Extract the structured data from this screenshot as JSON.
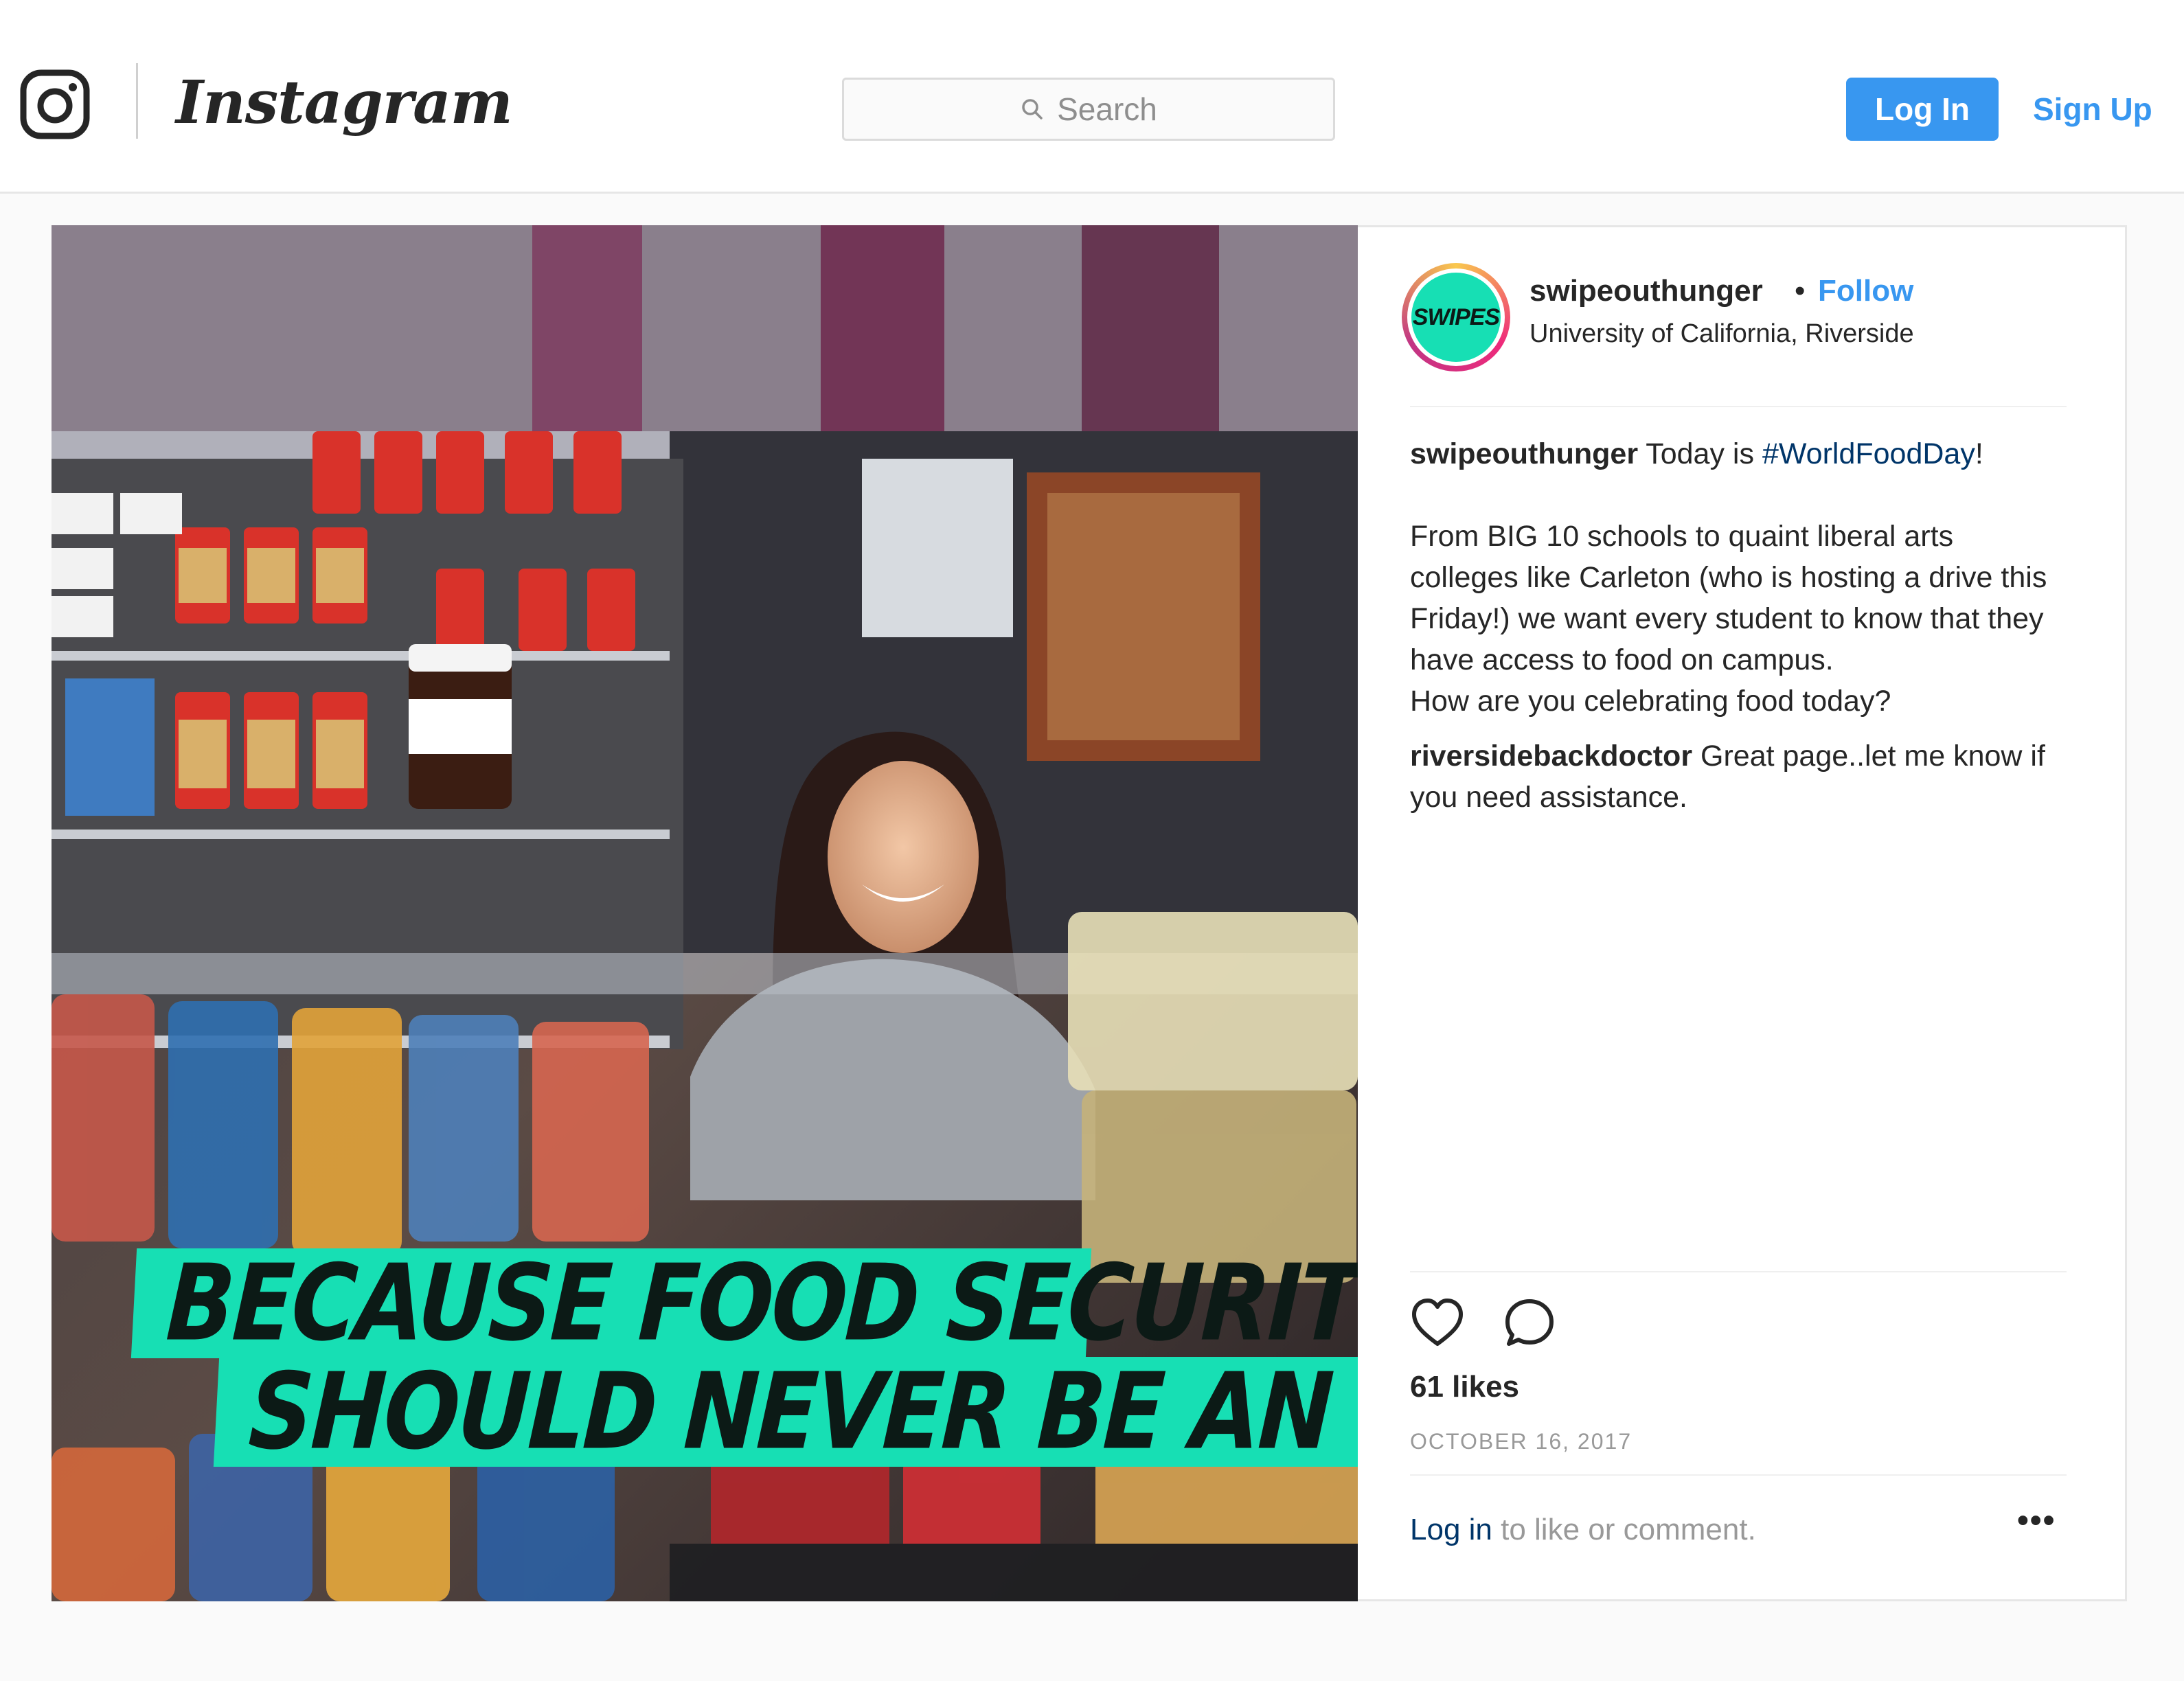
{
  "header": {
    "wordmark": "Instagram",
    "search_placeholder": "Search",
    "login_label": "Log In",
    "signup_label": "Sign Up"
  },
  "post": {
    "image_caption_line1": "BECAUSE FOOD SECURITY",
    "image_caption_line2": "SHOULD NEVER BE AN ELECTIVE",
    "image_accent_color": "#17dfb4",
    "avatar_text": "SWIPES",
    "username": "swipeouthunger",
    "dot": "•",
    "follow_label": "Follow",
    "location": "University of California, Riverside",
    "caption": {
      "username": "swipeouthunger",
      "intro": " Today is ",
      "hashtag": "#WorldFoodDay",
      "intro_end": "!",
      "body": "From BIG 10 schools to quaint liberal arts colleges like Carleton (who is hosting a drive this Friday!) we want every student to know that they have access to food on campus.",
      "question": "How are you celebrating food today?"
    },
    "comment": {
      "username": "riversidebackdoctor",
      "text": " Great page..let me know if you need assistance."
    },
    "likes": "61 likes",
    "date": "OCTOBER 16, 2017",
    "login_link": "Log in",
    "login_suffix": " to like or comment.",
    "more_label": "•••"
  },
  "colors": {
    "brand_blue": "#3897f0",
    "link_dark": "#003569",
    "muted": "#999999"
  },
  "icons": [
    "camera-logo-icon",
    "search-icon",
    "heart-icon",
    "comment-icon",
    "more-options-icon"
  ]
}
